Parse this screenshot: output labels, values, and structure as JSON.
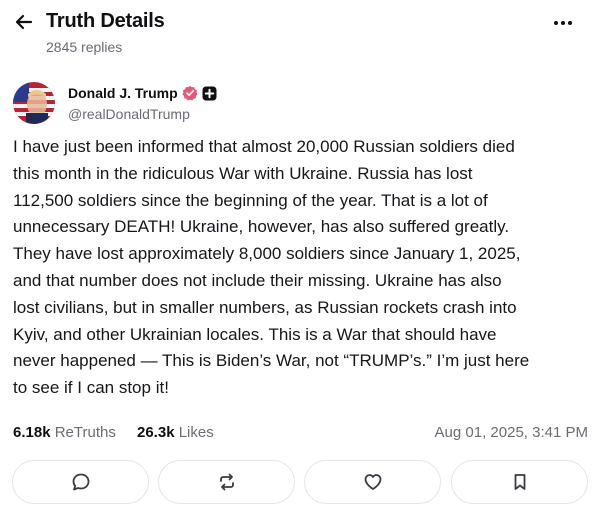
{
  "header": {
    "title": "Truth Details",
    "reply_count": "2845 replies",
    "back_icon": "arrow-left-icon",
    "more_icon": "more-horizontal-icon"
  },
  "post": {
    "display_name": "Donald J. Trump",
    "handle": "@realDonaldTrump",
    "verified_color": "#e05a7a",
    "body": "I have just been informed that almost 20,000 Russian soldiers died this month in the ridiculous War with Ukraine. Russia has lost 112,500 soldiers since the beginning of the year. That is a lot of unnecessary DEATH! Ukraine, however, has also suffered greatly. They have lost approximately 8,000 soldiers since January 1, 2025, and that number does not include their missing. Ukraine has also lost civilians, but in smaller numbers, as Russian rockets crash into Kyiv, and other Ukrainian locales. This is a War that should have never happened — This is Biden’s War, not “TRUMP’s.” I’m just here to see if I can stop it!",
    "body_lines": [
      "I have just been informed that almost 20,000 Russian soldiers died",
      "this month in the ridiculous War with Ukraine. Russia has lost",
      "112,500 soldiers since the beginning of the year. That is a lot of",
      "unnecessary DEATH! Ukraine, however, has also suffered greatly.",
      "They have lost approximately 8,000 soldiers since January 1, 2025,",
      "and that number does not include their missing. Ukraine has also",
      "lost civilians, but in smaller numbers, as Russian rockets crash into",
      "Kyiv, and other Ukrainian locales. This is a War that should have",
      "never happened — This is Biden’s War, not “TRUMP’s.” I’m just here",
      "to see if I can stop it!"
    ],
    "retruths_count": "6.18k",
    "retruths_label": "ReTruths",
    "likes_count": "26.3k",
    "likes_label": "Likes",
    "timestamp": "Aug 01, 2025, 3:41 PM"
  },
  "actions": [
    {
      "name": "reply-button",
      "icon": "comment-icon"
    },
    {
      "name": "retruth-button",
      "icon": "repost-icon"
    },
    {
      "name": "like-button",
      "icon": "heart-icon"
    },
    {
      "name": "bookmark-button",
      "icon": "bookmark-icon"
    }
  ]
}
